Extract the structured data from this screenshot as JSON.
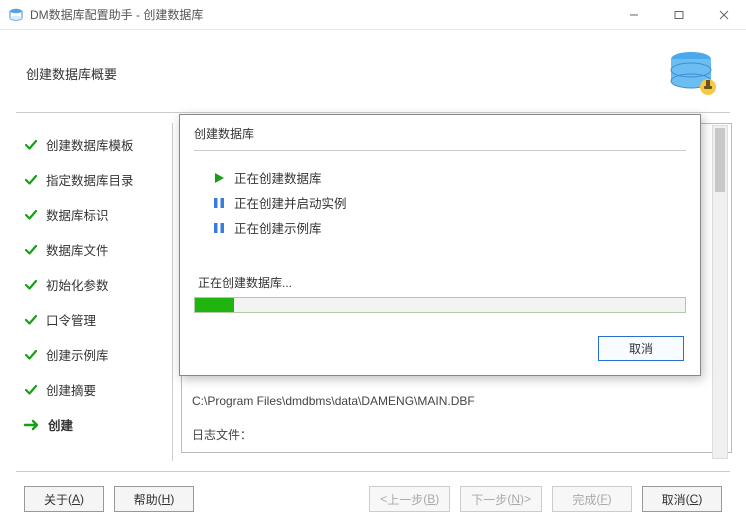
{
  "window": {
    "title": "DM数据库配置助手 - 创建数据库"
  },
  "header": {
    "title": "创建数据库概要"
  },
  "steps": {
    "s0": "创建数据库模板",
    "s1": "指定数据库目录",
    "s2": "数据库标识",
    "s3": "数据库文件",
    "s4": "初始化参数",
    "s5": "口令管理",
    "s6": "创建示例库",
    "s7": "创建摘要",
    "s8": "创建"
  },
  "background": {
    "path_line": "C:\\Program Files\\dmdbms\\data\\DAMENG\\MAIN.DBF",
    "log_label": "日志文件："
  },
  "modal": {
    "title": "创建数据库",
    "tasks": {
      "t0": "正在创建数据库",
      "t1": "正在创建并启动实例",
      "t2": "正在创建示例库"
    },
    "progress_label": "正在创建数据库...",
    "cancel": "取消"
  },
  "footer": {
    "about": "关于",
    "about_m": "A",
    "help": "帮助",
    "help_m": "H",
    "prev_prefix": "< ",
    "prev": "上一步",
    "prev_m": "B",
    "next": "下一步",
    "next_m": "N",
    "next_suffix": " >",
    "finish": "完成",
    "finish_m": "F",
    "cancel": "取消",
    "cancel_m": "C"
  }
}
